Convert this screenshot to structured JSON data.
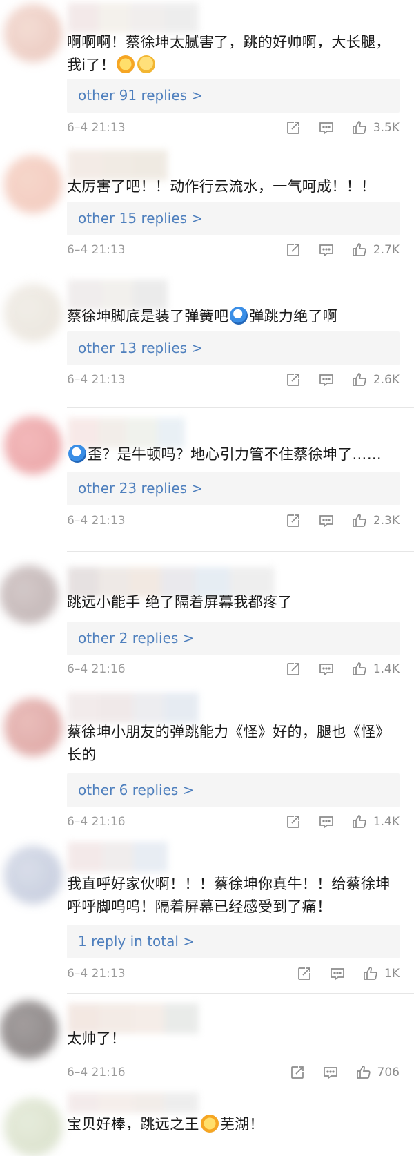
{
  "colors": {
    "reply_link": "#4e7fbd",
    "meta": "#9b9b9b",
    "text": "#1a1a1a"
  },
  "icons": {
    "repost": "share-square-icon",
    "comment": "comment-bubble-icon",
    "like": "thumbs-up-icon"
  },
  "comments": [
    {
      "text": "啊啊啊！蔡徐坤太腻害了，跳的好帅啊，大长腿，我i了！",
      "replies": "other 91 replies >",
      "date": "6–4 21:13",
      "likes": "3.5K"
    },
    {
      "text": "太厉害了吧！！动作行云流水，一气呵成！！！",
      "replies": "other 15 replies >",
      "date": "6–4 21:13",
      "likes": "2.7K"
    },
    {
      "text_a": "蔡徐坤脚底是装了弹簧吧",
      "text_b": "弹跳力绝了啊",
      "replies": "other 13 replies >",
      "date": "6–4 21:13",
      "likes": "2.6K"
    },
    {
      "text": "歪？是牛顿吗？地心引力管不住蔡徐坤了……",
      "replies": "other 23 replies >",
      "date": "6–4 21:13",
      "likes": "2.3K"
    },
    {
      "text": "跳远小能手 绝了隔着屏幕我都疼了",
      "replies": "other 2 replies >",
      "date": "6–4 21:16",
      "likes": "1.4K"
    },
    {
      "text": "蔡徐坤小朋友的弹跳能力《怪》好的，腿也《怪》长的",
      "replies": "other 6 replies >",
      "date": "6–4 21:16",
      "likes": "1.4K"
    },
    {
      "text": "我直呼好家伙啊！！！蔡徐坤你真牛！！给蔡徐坤呼呼脚呜呜！隔着屏幕已经感受到了痛！",
      "replies": "1 reply in total >",
      "date": "6–4 21:13",
      "likes": "1K"
    },
    {
      "text": "太帅了！",
      "date": "6–4 21:16",
      "likes": "706"
    },
    {
      "text_a": "宝贝好棒，跳远之王",
      "text_b": "芜湖！"
    }
  ]
}
